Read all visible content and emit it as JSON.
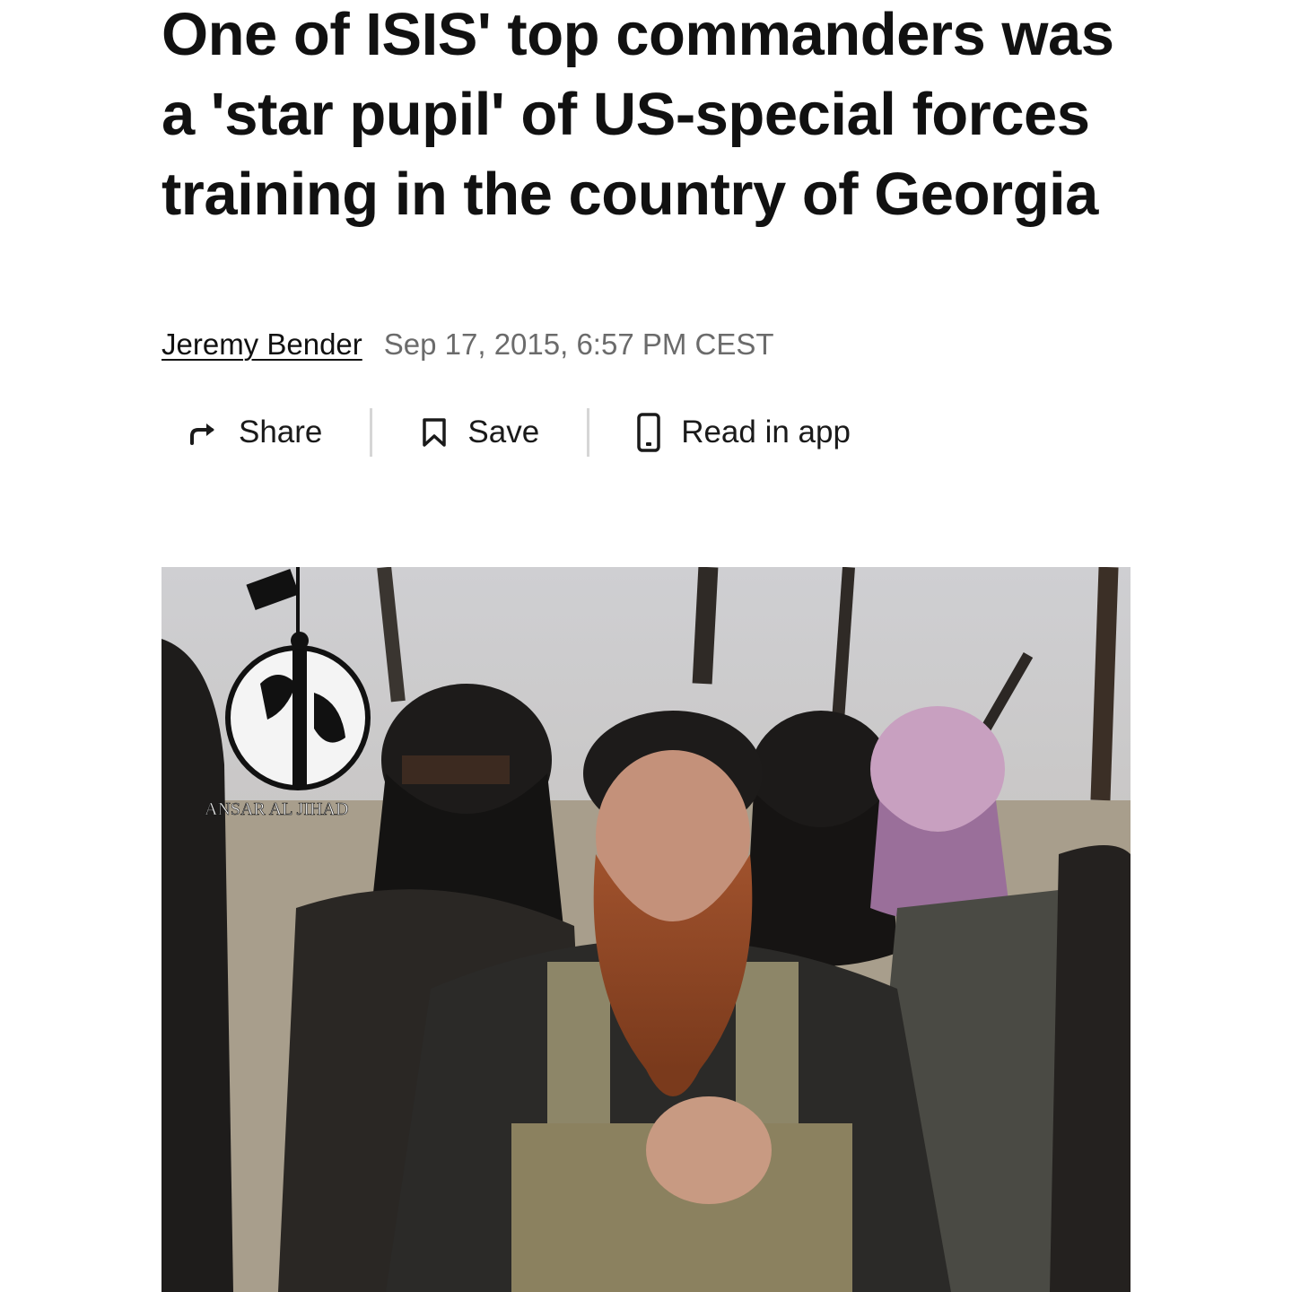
{
  "article": {
    "headline": "One of ISIS' top commanders was a 'star pupil' of US-special forces training in the country of Georgia",
    "author": "Jeremy Bender",
    "date": "Sep 17, 2015, 6:57 PM CEST"
  },
  "actions": {
    "share_label": "Share",
    "save_label": "Save",
    "read_in_app_label": "Read in app",
    "share_icon": "share-arrow-icon",
    "save_icon": "bookmark-icon",
    "read_in_app_icon": "phone-icon"
  },
  "hero_image": {
    "watermark_text": "ANSAR AL JIHAD",
    "logo": "globe-silhouette-logo"
  },
  "colors": {
    "text": "#111111",
    "meta": "#6b6b6b",
    "divider": "#d6d6d6"
  }
}
